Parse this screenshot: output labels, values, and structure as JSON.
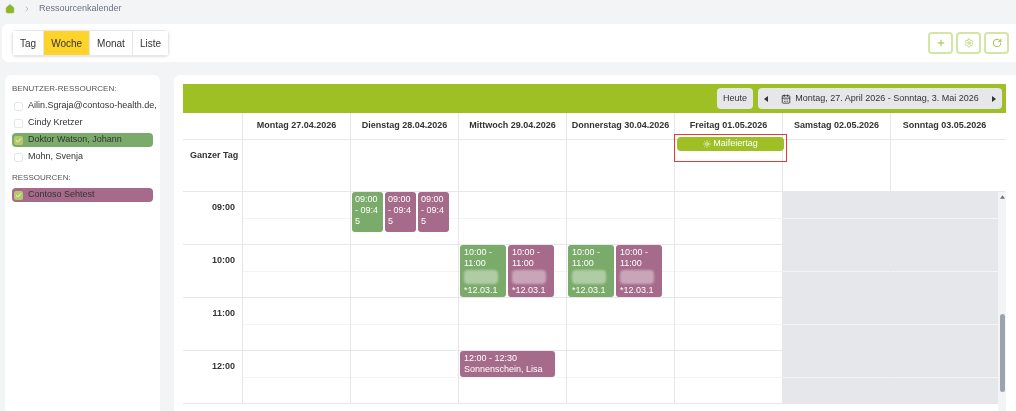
{
  "breadcrumb": {
    "label": "Ressourcenkalender"
  },
  "views": [
    {
      "label": "Tag",
      "selected": false
    },
    {
      "label": "Woche",
      "selected": true
    },
    {
      "label": "Monat",
      "selected": false
    },
    {
      "label": "Liste",
      "selected": false
    }
  ],
  "sidebar": {
    "groups": [
      {
        "title": "BENUTZER-RESSOURCEN:",
        "items": [
          {
            "label": "Ailin.Sgraja@contoso-health.de,",
            "checked": false
          },
          {
            "label": "Cindy Kretzer",
            "checked": false
          },
          {
            "label": "Doktor Watson, Johann",
            "checked": true,
            "color": "#7aab6a"
          },
          {
            "label": "Mohn, Svenja",
            "checked": false
          }
        ]
      },
      {
        "title": "RESSOURCEN:",
        "items": [
          {
            "label": "Contoso Sehtest",
            "checked": true,
            "color": "#a66a8a"
          }
        ]
      }
    ]
  },
  "calendar": {
    "today_button": "Heute",
    "range": "Montag, 27. April 2026 - Sonntag, 3. Mai 2026",
    "all_day_label": "Ganzer Tag",
    "days": [
      {
        "label": "Montag 27.04.2026",
        "weekend": false
      },
      {
        "label": "Dienstag 28.04.2026",
        "weekend": false
      },
      {
        "label": "Mittwoch 29.04.2026",
        "weekend": false
      },
      {
        "label": "Donnerstag 30.04.2026",
        "weekend": false
      },
      {
        "label": "Freitag 01.05.2026",
        "weekend": false,
        "all_day": [
          {
            "label": "Maifeiertag",
            "highlighted": true
          }
        ]
      },
      {
        "label": "Samstag 02.05.2026",
        "weekend": true
      },
      {
        "label": "Sonntag 03.05.2026",
        "weekend": true
      }
    ],
    "hours": [
      {
        "time": "09:00",
        "cells": [
          [],
          [
            {
              "time": "09:00 - 09:45",
              "color": "#7aab6a",
              "kind": "narrow"
            },
            {
              "time": "09:00 - 09:45",
              "color": "#a66a8a",
              "kind": "narrow"
            },
            {
              "time": "09:00 - 09:45",
              "color": "#a66a8a",
              "kind": "narrow"
            }
          ],
          [],
          [],
          [],
          [],
          []
        ]
      },
      {
        "time": "10:00",
        "cells": [
          [],
          [],
          [
            {
              "time": "10:00 - 11:00",
              "blurred": true,
              "detail": "*12.03.1",
              "color": "#7aab6a",
              "kind": "wide"
            },
            {
              "time": "10:00 - 11:00",
              "blurred": true,
              "detail": "*12.03.1",
              "color": "#a66a8a",
              "kind": "wide"
            }
          ],
          [
            {
              "time": "10:00 - 11:00",
              "blurred": true,
              "detail": "*12.03.1",
              "color": "#7aab6a",
              "kind": "wide"
            },
            {
              "time": "10:00 - 11:00",
              "blurred": true,
              "detail": "*12.03.1",
              "color": "#a66a8a",
              "kind": "wide"
            }
          ],
          [],
          [],
          []
        ]
      },
      {
        "time": "11:00",
        "cells": [
          [],
          [],
          [],
          [],
          [],
          [],
          []
        ]
      },
      {
        "time": "12:00",
        "cells": [
          [],
          [],
          [
            {
              "time": "12:00 - 12:30",
              "detail": "Sonnenschein, Lisa",
              "color": "#a66a8a",
              "kind": "half"
            }
          ],
          [],
          [],
          [],
          []
        ]
      }
    ]
  }
}
